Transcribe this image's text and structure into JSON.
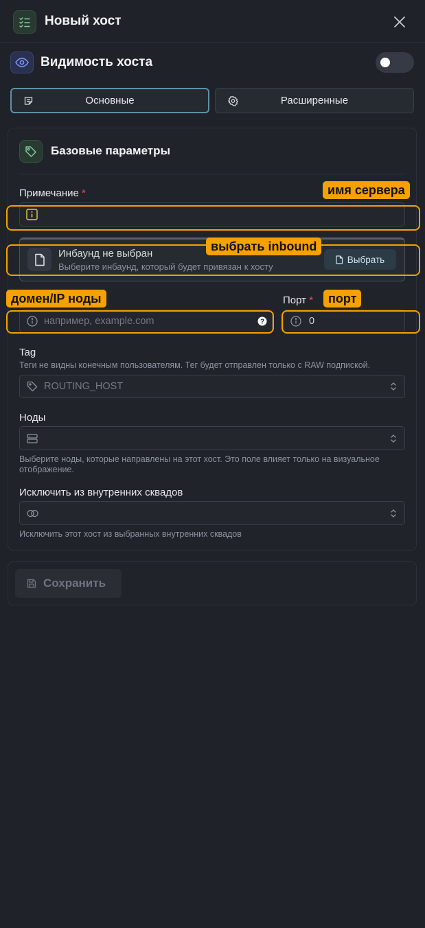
{
  "header": {
    "title": "Новый хост",
    "icon": "checklist-icon"
  },
  "visibility": {
    "title": "Видимость хоста",
    "toggle_on": false
  },
  "tabs": [
    {
      "label": "Основные",
      "active": true,
      "icon": "note-icon"
    },
    {
      "label": "Расширенные",
      "active": false,
      "icon": "gear-icon"
    }
  ],
  "card": {
    "title": "Базовые параметры",
    "icon": "tag-icon"
  },
  "remark": {
    "label": "Примечание",
    "required_mark": "*",
    "value": ""
  },
  "inbound": {
    "title": "Инбаунд не выбран",
    "subtitle": "Выберите инбаунд, который будет привязан к хосту",
    "button": "Выбрать"
  },
  "address": {
    "placeholder": "например, example.com"
  },
  "port": {
    "label": "Порт",
    "required_mark": "*",
    "value": "0"
  },
  "tag": {
    "label": "Tag",
    "hint": "Теги не видны конечным пользователям. Тег будет отправлен только с RAW подпиской.",
    "placeholder": "ROUTING_HOST"
  },
  "nodes": {
    "label": "Ноды",
    "hint": "Выберите ноды, которые направлены на этот хост. Это поле влияет только на визуальное отображение."
  },
  "exclude": {
    "label": "Исключить из внутренних сквадов",
    "hint": "Исключить этот хост из выбранных внутренних сквадов"
  },
  "save": {
    "label": "Сохранить"
  },
  "annotations": {
    "server_name": "имя сервера",
    "choose_inbound": "выбрать inbound",
    "node_address": "домен/IP ноды",
    "port": "порт"
  },
  "colors": {
    "accent_annotation": "#f5a100",
    "required": "#e55353",
    "background": "#1f2228"
  }
}
